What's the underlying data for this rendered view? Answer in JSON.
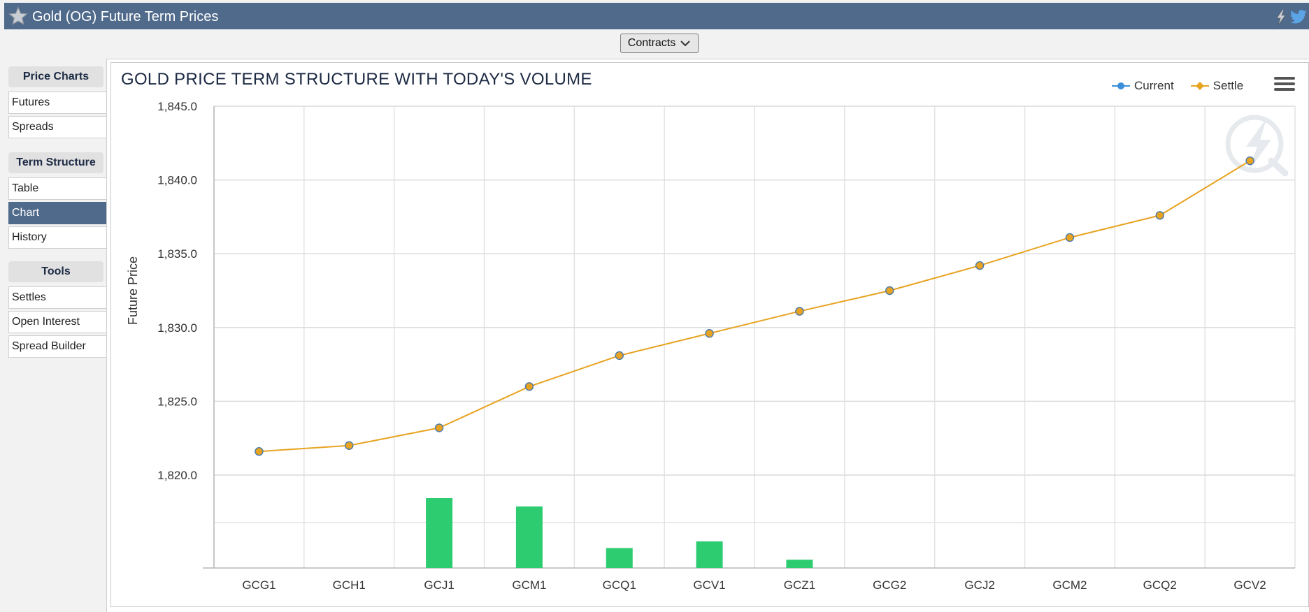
{
  "app": {
    "title": "Gold (OG) Future Term Prices",
    "star_icon": "star-icon",
    "share_icons": [
      "lightning-icon",
      "twitter-icon"
    ]
  },
  "toolbar": {
    "contracts_label": "Contracts"
  },
  "sidebar": {
    "sections": [
      {
        "header": "Price Charts",
        "items": [
          {
            "label": "Futures"
          },
          {
            "label": "Spreads"
          }
        ]
      },
      {
        "header": "Term Structure",
        "items": [
          {
            "label": "Table"
          },
          {
            "label": "Chart",
            "active": true
          },
          {
            "label": "History"
          }
        ]
      },
      {
        "header": "Tools",
        "items": [
          {
            "label": "Settles"
          },
          {
            "label": "Open Interest"
          },
          {
            "label": "Spread Builder"
          }
        ]
      }
    ]
  },
  "colors": {
    "header_bg": "#4f6a8b",
    "settle_line": "#e8a321",
    "current_marker": "#3a8fd9",
    "volume_bar": "#2ecc71"
  },
  "chart_data": {
    "type": "line",
    "title": "GOLD PRICE TERM STRUCTURE WITH TODAY'S VOLUME",
    "ylabel": "Future Price",
    "xlabel": "",
    "ylim": [
      1820.0,
      1845.0
    ],
    "yticks": [
      "1,845.0",
      "1,840.0",
      "1,835.0",
      "1,830.0",
      "1,825.0",
      "1,820.0"
    ],
    "categories": [
      "GCG1",
      "GCH1",
      "GCJ1",
      "GCM1",
      "GCQ1",
      "GCV1",
      "GCZ1",
      "GCG2",
      "GCJ2",
      "GCM2",
      "GCQ2",
      "GCV2"
    ],
    "series": [
      {
        "name": "Current",
        "type": "scatter",
        "values": [
          1821.6,
          1822.0,
          1823.2,
          1826.0,
          1828.1,
          1829.6,
          1831.1,
          1832.5,
          1834.2,
          1836.1,
          1837.6,
          1841.3
        ]
      },
      {
        "name": "Settle",
        "type": "line",
        "values": [
          1821.6,
          1822.0,
          1823.2,
          1826.0,
          1828.1,
          1829.6,
          1831.1,
          1832.5,
          1834.2,
          1836.1,
          1837.6,
          1841.3
        ]
      },
      {
        "type": "bar",
        "values": [
          0,
          0,
          84,
          74,
          24,
          32,
          10,
          0,
          0,
          0,
          0,
          0
        ]
      }
    ],
    "grid": true,
    "legend_position": "top-right"
  }
}
